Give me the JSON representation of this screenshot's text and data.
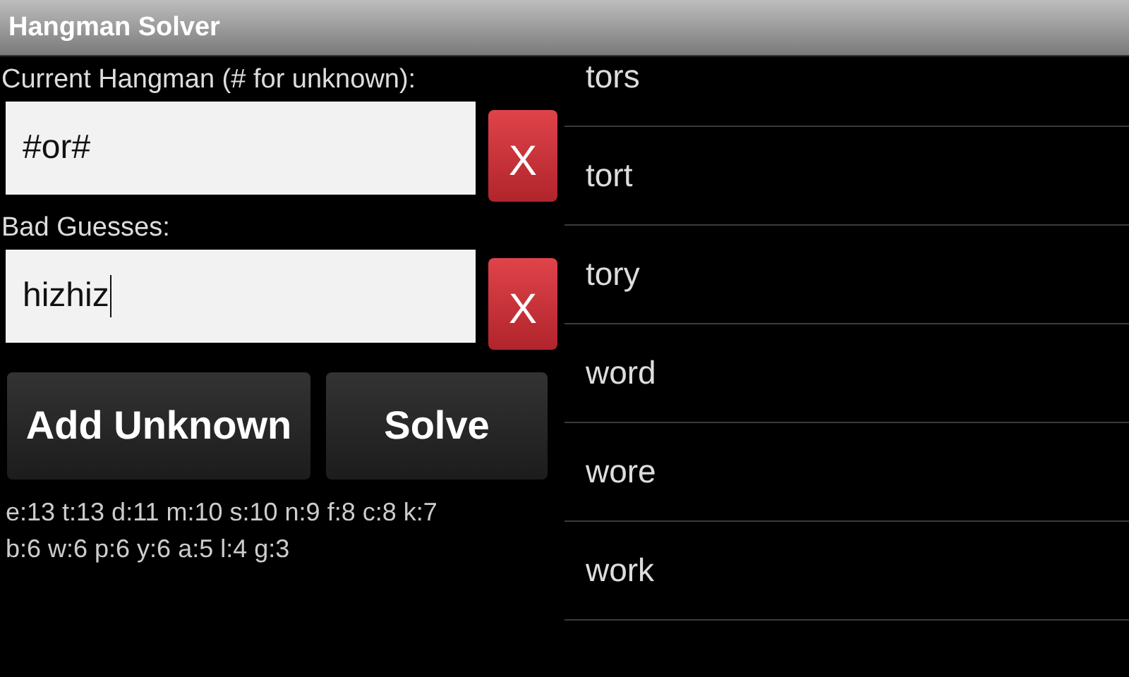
{
  "window": {
    "title": "Hangman Solver"
  },
  "fields": [
    {
      "label": "Current Hangman (# for unknown):",
      "value": "#or#",
      "focused": false,
      "clear_button": "X"
    },
    {
      "label": "Bad Guesses:",
      "value": "hizhiz",
      "focused": true,
      "clear_button": "X"
    }
  ],
  "buttons": [
    "Add Unknown",
    "Solve"
  ],
  "letter_counts": [
    "e:13 t:13 d:11 m:10 s:10 n:9 f:8 c:8 k:7",
    "b:6 w:6 p:6 y:6 a:5 l:4 g:3"
  ],
  "results": [
    "tors",
    "tort",
    "tory",
    "word",
    "wore",
    "work"
  ]
}
